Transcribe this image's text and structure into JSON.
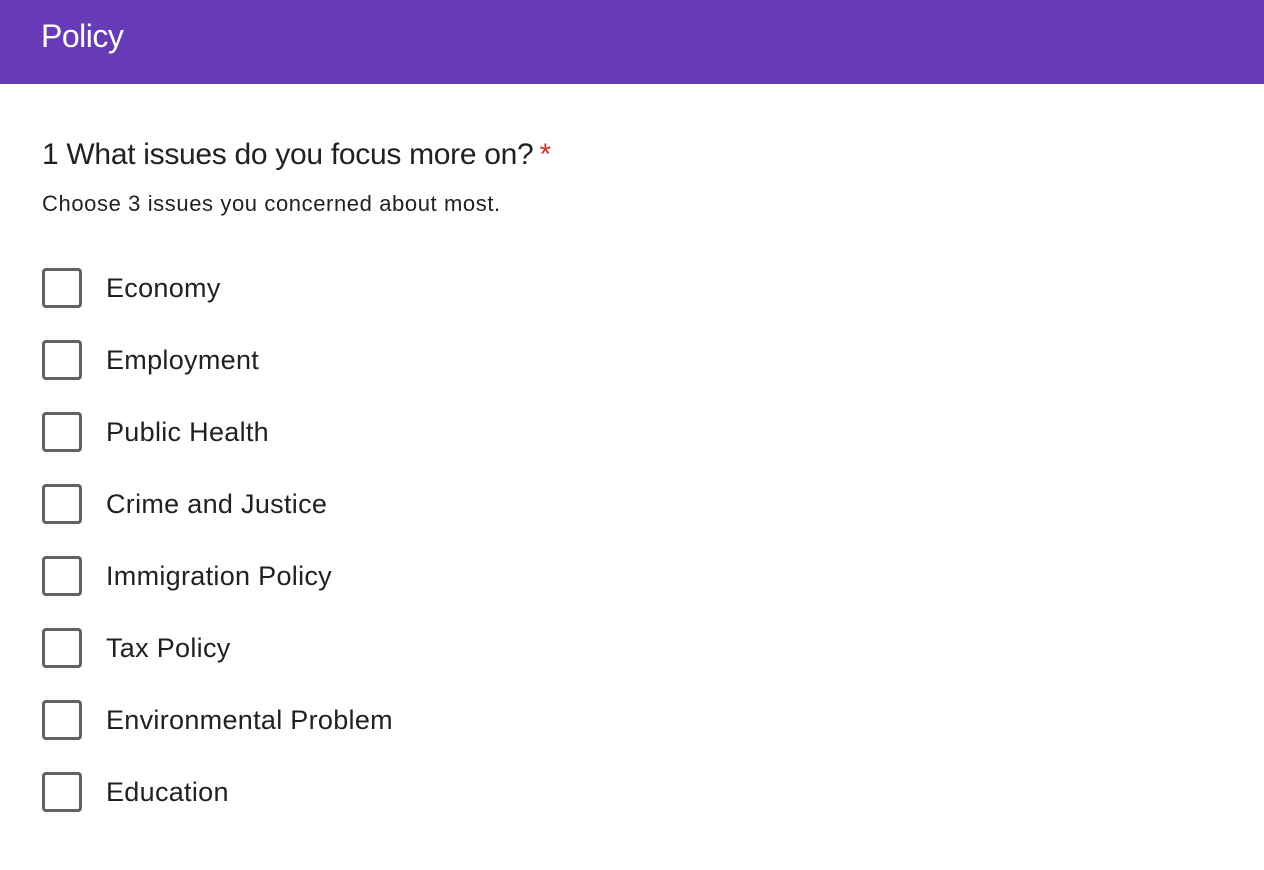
{
  "header": {
    "title": "Policy",
    "color": "#673ab7"
  },
  "question": {
    "title": "1 What issues do you focus more on?",
    "required_mark": "*",
    "description": "Choose 3 issues you concerned about most."
  },
  "options": [
    {
      "label": "Economy",
      "checked": false
    },
    {
      "label": "Employment",
      "checked": false
    },
    {
      "label": "Public Health",
      "checked": false
    },
    {
      "label": "Crime and Justice",
      "checked": false
    },
    {
      "label": "Immigration Policy",
      "checked": false
    },
    {
      "label": "Tax Policy",
      "checked": false
    },
    {
      "label": "Environmental Problem",
      "checked": false
    },
    {
      "label": "Education",
      "checked": false
    }
  ]
}
